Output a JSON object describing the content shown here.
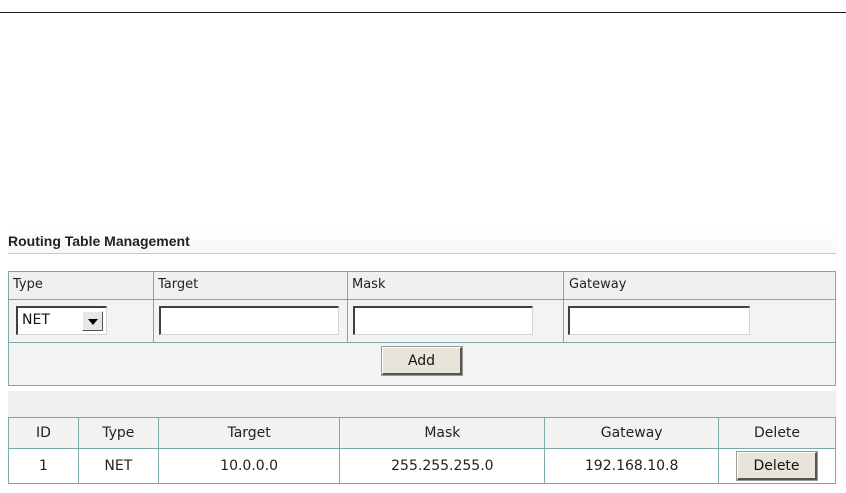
{
  "section_title": "Routing Table Management",
  "form": {
    "headers": {
      "type": "Type",
      "target": "Target",
      "mask": "Mask",
      "gateway": "Gateway"
    },
    "type_select": {
      "selected": "NET"
    },
    "target_value": "",
    "mask_value": "",
    "gateway_value": "",
    "add_label": "Add"
  },
  "table": {
    "columns": [
      "ID",
      "Type",
      "Target",
      "Mask",
      "Gateway",
      "Delete"
    ],
    "rows": [
      {
        "id": "1",
        "type": "NET",
        "target": "10.0.0.0",
        "mask": "255.255.255.0",
        "gateway": "192.168.10.8",
        "delete_label": "Delete"
      }
    ]
  }
}
